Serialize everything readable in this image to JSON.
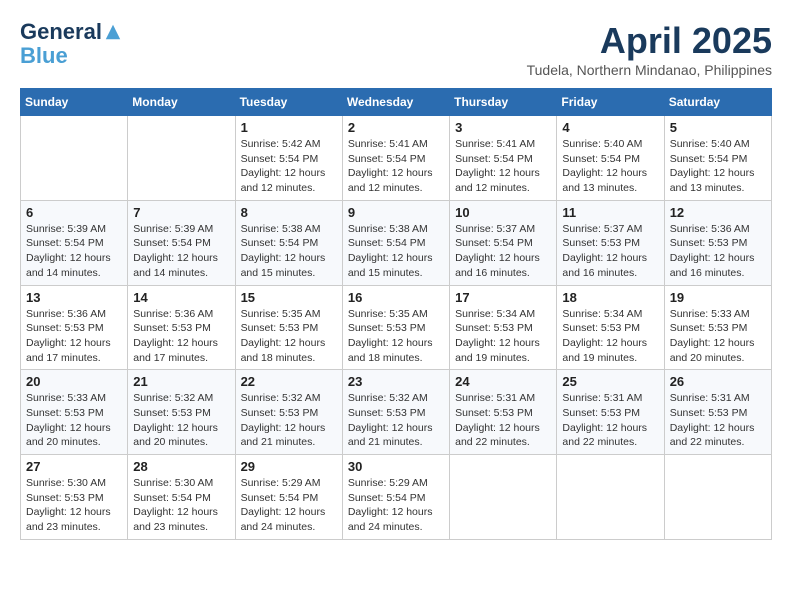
{
  "header": {
    "logo_line1": "General",
    "logo_line2": "Blue",
    "month": "April 2025",
    "location": "Tudela, Northern Mindanao, Philippines"
  },
  "weekdays": [
    "Sunday",
    "Monday",
    "Tuesday",
    "Wednesday",
    "Thursday",
    "Friday",
    "Saturday"
  ],
  "weeks": [
    [
      {
        "day": "",
        "info": ""
      },
      {
        "day": "",
        "info": ""
      },
      {
        "day": "1",
        "info": "Sunrise: 5:42 AM\nSunset: 5:54 PM\nDaylight: 12 hours\nand 12 minutes."
      },
      {
        "day": "2",
        "info": "Sunrise: 5:41 AM\nSunset: 5:54 PM\nDaylight: 12 hours\nand 12 minutes."
      },
      {
        "day": "3",
        "info": "Sunrise: 5:41 AM\nSunset: 5:54 PM\nDaylight: 12 hours\nand 12 minutes."
      },
      {
        "day": "4",
        "info": "Sunrise: 5:40 AM\nSunset: 5:54 PM\nDaylight: 12 hours\nand 13 minutes."
      },
      {
        "day": "5",
        "info": "Sunrise: 5:40 AM\nSunset: 5:54 PM\nDaylight: 12 hours\nand 13 minutes."
      }
    ],
    [
      {
        "day": "6",
        "info": "Sunrise: 5:39 AM\nSunset: 5:54 PM\nDaylight: 12 hours\nand 14 minutes."
      },
      {
        "day": "7",
        "info": "Sunrise: 5:39 AM\nSunset: 5:54 PM\nDaylight: 12 hours\nand 14 minutes."
      },
      {
        "day": "8",
        "info": "Sunrise: 5:38 AM\nSunset: 5:54 PM\nDaylight: 12 hours\nand 15 minutes."
      },
      {
        "day": "9",
        "info": "Sunrise: 5:38 AM\nSunset: 5:54 PM\nDaylight: 12 hours\nand 15 minutes."
      },
      {
        "day": "10",
        "info": "Sunrise: 5:37 AM\nSunset: 5:54 PM\nDaylight: 12 hours\nand 16 minutes."
      },
      {
        "day": "11",
        "info": "Sunrise: 5:37 AM\nSunset: 5:53 PM\nDaylight: 12 hours\nand 16 minutes."
      },
      {
        "day": "12",
        "info": "Sunrise: 5:36 AM\nSunset: 5:53 PM\nDaylight: 12 hours\nand 16 minutes."
      }
    ],
    [
      {
        "day": "13",
        "info": "Sunrise: 5:36 AM\nSunset: 5:53 PM\nDaylight: 12 hours\nand 17 minutes."
      },
      {
        "day": "14",
        "info": "Sunrise: 5:36 AM\nSunset: 5:53 PM\nDaylight: 12 hours\nand 17 minutes."
      },
      {
        "day": "15",
        "info": "Sunrise: 5:35 AM\nSunset: 5:53 PM\nDaylight: 12 hours\nand 18 minutes."
      },
      {
        "day": "16",
        "info": "Sunrise: 5:35 AM\nSunset: 5:53 PM\nDaylight: 12 hours\nand 18 minutes."
      },
      {
        "day": "17",
        "info": "Sunrise: 5:34 AM\nSunset: 5:53 PM\nDaylight: 12 hours\nand 19 minutes."
      },
      {
        "day": "18",
        "info": "Sunrise: 5:34 AM\nSunset: 5:53 PM\nDaylight: 12 hours\nand 19 minutes."
      },
      {
        "day": "19",
        "info": "Sunrise: 5:33 AM\nSunset: 5:53 PM\nDaylight: 12 hours\nand 20 minutes."
      }
    ],
    [
      {
        "day": "20",
        "info": "Sunrise: 5:33 AM\nSunset: 5:53 PM\nDaylight: 12 hours\nand 20 minutes."
      },
      {
        "day": "21",
        "info": "Sunrise: 5:32 AM\nSunset: 5:53 PM\nDaylight: 12 hours\nand 20 minutes."
      },
      {
        "day": "22",
        "info": "Sunrise: 5:32 AM\nSunset: 5:53 PM\nDaylight: 12 hours\nand 21 minutes."
      },
      {
        "day": "23",
        "info": "Sunrise: 5:32 AM\nSunset: 5:53 PM\nDaylight: 12 hours\nand 21 minutes."
      },
      {
        "day": "24",
        "info": "Sunrise: 5:31 AM\nSunset: 5:53 PM\nDaylight: 12 hours\nand 22 minutes."
      },
      {
        "day": "25",
        "info": "Sunrise: 5:31 AM\nSunset: 5:53 PM\nDaylight: 12 hours\nand 22 minutes."
      },
      {
        "day": "26",
        "info": "Sunrise: 5:31 AM\nSunset: 5:53 PM\nDaylight: 12 hours\nand 22 minutes."
      }
    ],
    [
      {
        "day": "27",
        "info": "Sunrise: 5:30 AM\nSunset: 5:53 PM\nDaylight: 12 hours\nand 23 minutes."
      },
      {
        "day": "28",
        "info": "Sunrise: 5:30 AM\nSunset: 5:54 PM\nDaylight: 12 hours\nand 23 minutes."
      },
      {
        "day": "29",
        "info": "Sunrise: 5:29 AM\nSunset: 5:54 PM\nDaylight: 12 hours\nand 24 minutes."
      },
      {
        "day": "30",
        "info": "Sunrise: 5:29 AM\nSunset: 5:54 PM\nDaylight: 12 hours\nand 24 minutes."
      },
      {
        "day": "",
        "info": ""
      },
      {
        "day": "",
        "info": ""
      },
      {
        "day": "",
        "info": ""
      }
    ]
  ]
}
